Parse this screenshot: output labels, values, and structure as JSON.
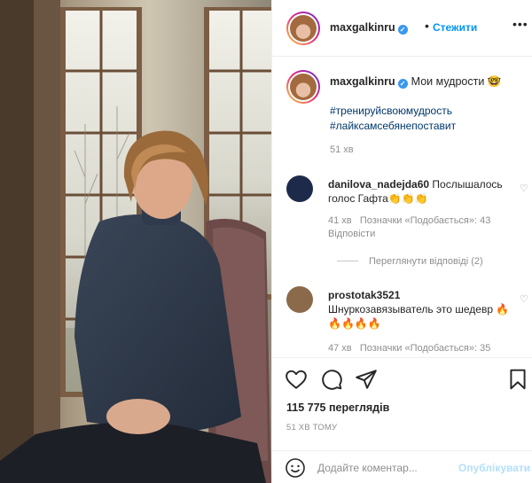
{
  "header": {
    "username": "maxgalkinru",
    "dot": "•",
    "follow_label": "Стежити",
    "more_label": "•••"
  },
  "caption": {
    "username": "maxgalkinru",
    "text": "Мои мудрости 🤓",
    "hashtags": [
      "#тренируйсвоюмудрость",
      "#лайксамсебянепоставит"
    ],
    "time": "51 хв"
  },
  "comments": [
    {
      "username": "danilova_nadejda60",
      "text": "Послышалось голос Гафта👏👏👏",
      "time": "41 хв",
      "likes": "Позначки «Подобається»: 43",
      "reply_label": "Відповісти",
      "view_replies": "Переглянути відповіді (2)",
      "avatar_color": "#1e2a4a"
    },
    {
      "username": "prostotak3521",
      "text": "Шнуркозавязыватель это шедевр 🔥🔥🔥🔥🔥",
      "time": "47 хв",
      "likes": "Позначки «Подобається»: 35",
      "avatar_color": "#8a6a4a"
    }
  ],
  "actions": {
    "icons": [
      "heart-icon",
      "comment-icon",
      "share-icon",
      "bookmark-icon"
    ],
    "views": "115 775 переглядів",
    "time_ago": "51 ХВ ТОМУ"
  },
  "composer": {
    "placeholder": "Додайте коментар...",
    "publish_label": "Опублікувати"
  },
  "colors": {
    "accent": "#0095f6",
    "verified": "#3897f0",
    "publish_disabled": "#b2dffc",
    "hashtag": "#00376b",
    "muted": "#8e8e8e"
  }
}
